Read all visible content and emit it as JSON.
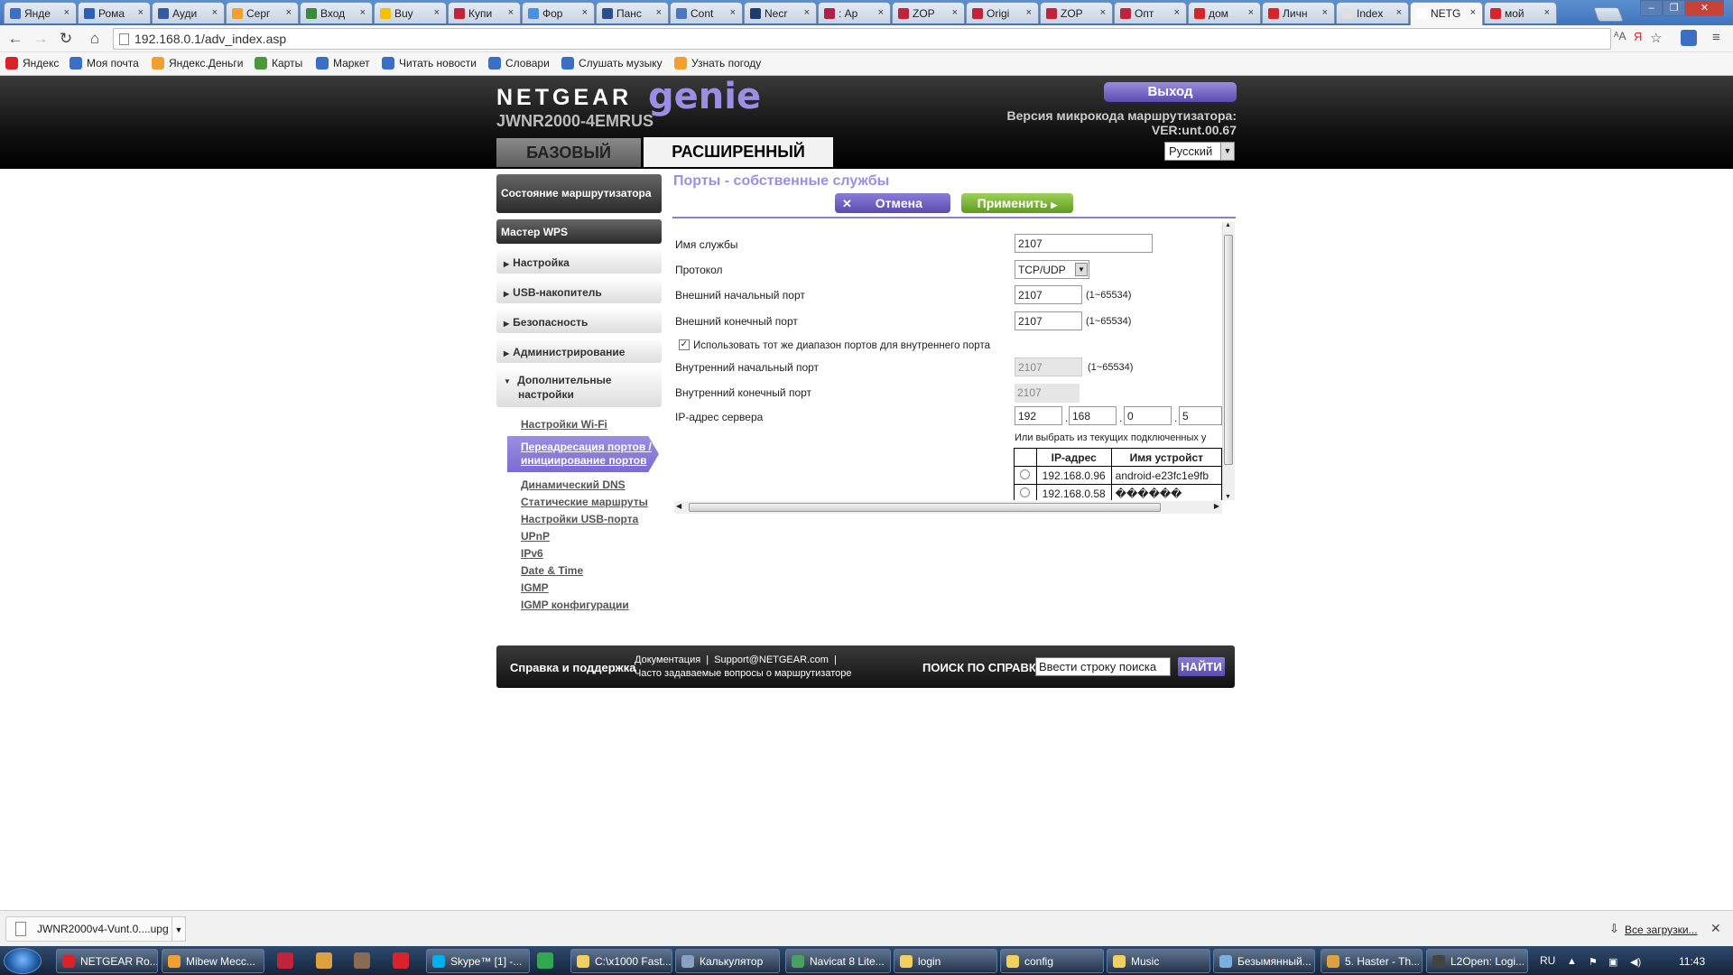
{
  "browser": {
    "tabs": [
      {
        "title": "Янде",
        "color": "#3a6fc4"
      },
      {
        "title": "Рома",
        "color": "#2b5fb8"
      },
      {
        "title": "Ауди",
        "color": "#345c9c"
      },
      {
        "title": "Серг",
        "color": "#f0a030"
      },
      {
        "title": "Вход",
        "color": "#3a8a3a"
      },
      {
        "title": "Buy",
        "color": "#f2c200"
      },
      {
        "title": "Купи",
        "color": "#c0233a"
      },
      {
        "title": "Фор",
        "color": "#4a90e2"
      },
      {
        "title": "Панс",
        "color": "#2b4f8a"
      },
      {
        "title": "Cont",
        "color": "#4a77c0"
      },
      {
        "title": "Necr",
        "color": "#1d3d6e"
      },
      {
        "title": ": Ар",
        "color": "#b0204a"
      },
      {
        "title": "ZOP",
        "color": "#c0233a"
      },
      {
        "title": "Origi",
        "color": "#c0233a"
      },
      {
        "title": "ZOP",
        "color": "#c0233a"
      },
      {
        "title": "Опт",
        "color": "#c0233a"
      },
      {
        "title": "дом",
        "color": "#d8232a"
      },
      {
        "title": "Личн",
        "color": "#d8232a"
      },
      {
        "title": "Index",
        "color": "#e0e0e0"
      },
      {
        "title": "NETG",
        "color": "#ffffff"
      },
      {
        "title": "мой",
        "color": "#d8232a"
      }
    ],
    "active_tab_index": 19,
    "close_glyph": "×",
    "url": "192.168.0.1/adv_index.asp",
    "bookmarks": [
      {
        "label": "Яндекс",
        "color": "#d8232a"
      },
      {
        "label": "Моя почта",
        "color": "#3a6fc4"
      },
      {
        "label": "Яндекс.Деньги",
        "color": "#f0a030"
      },
      {
        "label": "Карты",
        "color": "#4a9a3a"
      },
      {
        "label": "Маркет",
        "color": "#3a6fc4"
      },
      {
        "label": "Читать новости",
        "color": "#3a6fc4"
      },
      {
        "label": "Словари",
        "color": "#3a6fc4"
      },
      {
        "label": "Слушать музыку",
        "color": "#3a6fc4"
      },
      {
        "label": "Узнать погоду",
        "color": "#f0a030"
      }
    ]
  },
  "router": {
    "brand": "NETGEAR",
    "product": "genie",
    "model": "JWNR2000-4EMRUS",
    "logout_label": "Выход",
    "firmware_label": "Версия микрокода маршрутизатора:",
    "firmware_value": "VER:unt.00.67",
    "language": "Русский",
    "tab_basic": "БАЗОВЫЙ РЕЖИМ",
    "tab_advanced": "РАСШИРЕННЫЙ"
  },
  "sidebar": {
    "status": "Состояние маршрутизатора",
    "wps": "Мастер WPS",
    "sections": [
      "Настройка",
      "USB-накопитель",
      "Безопасность",
      "Администрирование"
    ],
    "advanced_title_line1": "Дополнительные",
    "advanced_title_line2": "настройки",
    "sub_wifi": "Настройки Wi-Fi",
    "sub_active_line1": "Переадресация портов /",
    "sub_active_line2": "инициирование портов",
    "sub_items": [
      "Динамический DNS",
      "Статические маршруты",
      "Настройки USB-порта",
      "UPnP",
      "IPv6",
      "Date & Time",
      "IGMP",
      "IGMP конфигурации"
    ]
  },
  "form": {
    "title": "Порты - собственные службы",
    "cancel": "Отмена",
    "apply": "Применить",
    "service_name_label": "Имя службы",
    "service_name": "2107",
    "protocol_label": "Протокол",
    "protocol": "TCP/UDP",
    "ext_start_label": "Внешний начальный порт",
    "ext_start": "2107",
    "ext_end_label": "Внешний конечный порт",
    "ext_end": "2107",
    "range_hint": "(1~65534)",
    "same_range_label": "Использовать тот же диапазон портов для внутреннего порта",
    "same_range_checked": true,
    "int_start_label": "Внутренний начальный порт",
    "int_start": "2107",
    "int_end_label": "Внутренний конечный порт",
    "int_end": "2107",
    "server_ip_label": "IP-адрес сервера",
    "ip": [
      "192",
      "168",
      "0",
      "5"
    ],
    "choose_hint": "Или выбрать из текущих подключенных у",
    "table_headers": [
      "IP-адрес",
      "Имя устройст"
    ],
    "devices": [
      {
        "ip": "192.168.0.96",
        "name": "android-e23fc1e9fb"
      },
      {
        "ip": "192.168.0.58",
        "name": "������"
      }
    ]
  },
  "footer": {
    "title": "Справка и поддержка",
    "doc_link": "Документация",
    "support_link": "Support@NETGEAR.com",
    "faq_link": "Часто задаваемые вопросы о маршрутизаторе",
    "search_label": "ПОИСК ПО СПРАВКЕ",
    "search_placeholder": "Ввести строку поиска",
    "find_button": "НАЙТИ"
  },
  "downloads": {
    "file": "JWNR2000v4-Vunt.0....upg",
    "all_link": "Все загрузки..."
  },
  "taskbar": {
    "items": [
      {
        "label": "NETGEAR Ro...",
        "color": "#d8232a"
      },
      {
        "label": "Mibew Месс...",
        "color": "#f0a030"
      },
      {
        "label": "Skype™ [1] -...",
        "color": "#00aff0"
      },
      {
        "label": "C:\\x1000 Fast...",
        "color": "#f2d060"
      },
      {
        "label": "Калькулятор",
        "color": "#8aa0c0"
      },
      {
        "label": "Navicat 8 Lite...",
        "color": "#4aa060"
      },
      {
        "label": "login",
        "color": "#f2d060"
      },
      {
        "label": "config",
        "color": "#f2d060"
      },
      {
        "label": "Music",
        "color": "#f2d060"
      },
      {
        "label": "Безымянный...",
        "color": "#7ab0e0"
      },
      {
        "label": "5. Haster - Th...",
        "color": "#e0a040"
      },
      {
        "label": "L2Open: Logi...",
        "color": "#444444"
      }
    ],
    "lang": "RU",
    "clock": "11:43"
  }
}
